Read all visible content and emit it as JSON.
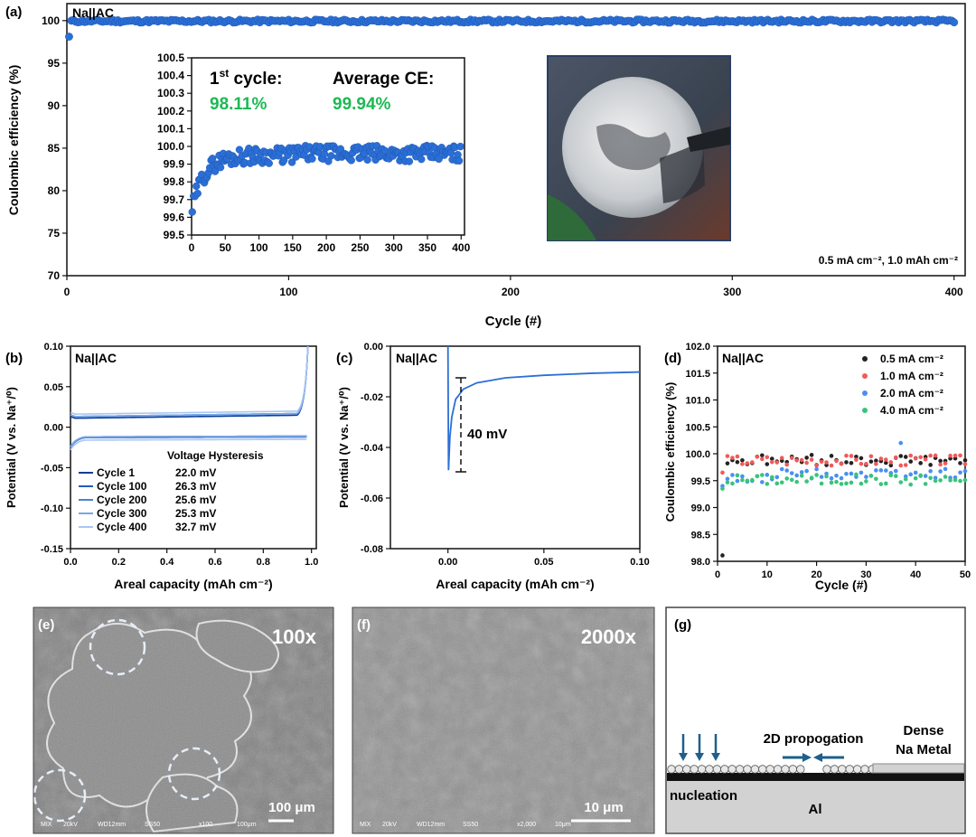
{
  "panel_a": {
    "label": "(a)",
    "tag": "Na||AC",
    "xlabel": "Cycle (#)",
    "ylabel": "Coulombic efficiency (%)",
    "conditions": "0.5 mA cm⁻², 1.0 mAh cm⁻²",
    "inset": {
      "first_cycle_label": "1st cycle:",
      "first_cycle_value": "98.11%",
      "avg_label": "Average CE:",
      "avg_value": "99.94%"
    }
  },
  "panel_b": {
    "label": "(b)",
    "tag": "Na||AC",
    "xlabel": "Areal capacity (mAh cm⁻²)",
    "ylabel": "Potential (V vs. Na⁺/⁰)",
    "legend_title": "Voltage Hysteresis",
    "legend": [
      {
        "name": "Cycle 1",
        "value": "22.0 mV"
      },
      {
        "name": "Cycle 100",
        "value": "26.3 mV"
      },
      {
        "name": "Cycle 200",
        "value": "25.6 mV"
      },
      {
        "name": "Cycle 300",
        "value": "25.3 mV"
      },
      {
        "name": "Cycle 400",
        "value": "32.7 mV"
      }
    ]
  },
  "panel_c": {
    "label": "(c)",
    "tag": "Na||AC",
    "xlabel": "Areal capacity (mAh cm⁻²)",
    "ylabel": "Potential (V vs. Na⁺/⁰)",
    "annotation": "40 mV"
  },
  "panel_d": {
    "label": "(d)",
    "tag": "Na||AC",
    "xlabel": "Cycle (#)",
    "ylabel": "Coulombic efficiency (%)",
    "legend": [
      "0.5 mA cm⁻²",
      "1.0 mA cm⁻²",
      "2.0 mA cm⁻²",
      "4.0 mA cm⁻²"
    ]
  },
  "panel_e": {
    "label": "(e)",
    "mag": "100x",
    "scale": "100 μm",
    "footer": [
      "MIX",
      "20kV",
      "WD12mm",
      "SS50",
      "x100",
      "100μm"
    ]
  },
  "panel_f": {
    "label": "(f)",
    "mag": "2000x",
    "scale": "10 μm",
    "footer": [
      "MIX",
      "20kV",
      "WD12mm",
      "SS50",
      "x2,000",
      "10μm"
    ]
  },
  "panel_g": {
    "label": "(g)",
    "propagation": "2D propogation",
    "dense_1": "Dense",
    "dense_2": "Na Metal",
    "nucleation": "nucleation",
    "substrate": "Al"
  },
  "colors": {
    "blue": "#2b6fd6",
    "black": "#222222",
    "red": "#f05a5a",
    "lightblue": "#4a8ff0",
    "green": "#39c47a"
  },
  "chart_data": [
    {
      "id": "a",
      "type": "scatter",
      "xlabel": "Cycle (#)",
      "ylabel": "Coulombic efficiency (%)",
      "xlim": [
        0,
        405
      ],
      "ylim": [
        70,
        102
      ],
      "xticks": [
        0,
        100,
        200,
        300,
        400
      ],
      "yticks": [
        70,
        75,
        80,
        85,
        90,
        95,
        100
      ],
      "series": [
        {
          "x_range": [
            1,
            400
          ],
          "first_value": 98.11,
          "steady_value": 99.94
        }
      ]
    },
    {
      "id": "a_inset",
      "type": "scatter",
      "xlim": [
        0,
        405
      ],
      "ylim": [
        99.5,
        100.5
      ],
      "xticks": [
        0,
        50,
        100,
        150,
        200,
        250,
        300,
        350,
        400
      ],
      "yticks": [
        99.5,
        99.6,
        99.7,
        99.8,
        99.9,
        100.0,
        100.1,
        100.2,
        100.3,
        100.4,
        100.5
      ],
      "series": [
        {
          "start": 99.63,
          "plateau": 99.95,
          "x_range": [
            1,
            400
          ]
        }
      ]
    },
    {
      "id": "b",
      "type": "line",
      "xlim": [
        0,
        1.02
      ],
      "ylim": [
        -0.15,
        0.1
      ],
      "xticks": [
        0.0,
        0.2,
        0.4,
        0.6,
        0.8,
        1.0
      ],
      "yticks": [
        -0.15,
        -0.1,
        -0.05,
        0.0,
        0.05,
        0.1
      ],
      "series": [
        {
          "name": "Cycle 1",
          "charge": 0.011,
          "discharge": -0.012
        },
        {
          "name": "Cycle 100",
          "charge": 0.013,
          "discharge": -0.013
        },
        {
          "name": "Cycle 200",
          "charge": 0.013,
          "discharge": -0.013
        },
        {
          "name": "Cycle 300",
          "charge": 0.013,
          "discharge": -0.012
        },
        {
          "name": "Cycle 400",
          "charge": 0.016,
          "discharge": -0.016
        }
      ]
    },
    {
      "id": "c",
      "type": "line",
      "xlim": [
        -0.03,
        0.1
      ],
      "ylim": [
        -0.08,
        0.0
      ],
      "xticks": [
        0.0,
        0.05,
        0.1
      ],
      "yticks": [
        -0.08,
        -0.06,
        -0.04,
        -0.02,
        0.0
      ],
      "series": [
        {
          "x": [
            0.0,
            0.0003,
            0.001,
            0.002,
            0.004,
            0.008,
            0.015,
            0.03,
            0.05,
            0.075,
            0.1
          ],
          "y": [
            0.0,
            -0.049,
            -0.036,
            -0.028,
            -0.021,
            -0.017,
            -0.0145,
            -0.0125,
            -0.0115,
            -0.0107,
            -0.0102
          ]
        }
      ]
    },
    {
      "id": "d",
      "type": "scatter",
      "xlim": [
        0,
        50
      ],
      "ylim": [
        98.0,
        102.0
      ],
      "xticks": [
        0,
        10,
        20,
        30,
        40,
        50
      ],
      "yticks": [
        98.0,
        98.5,
        99.0,
        99.5,
        100.0,
        100.5,
        101.0,
        101.5,
        102.0
      ],
      "series": [
        {
          "name": "0.5 mA cm⁻²",
          "first": 98.11,
          "mean": 99.88
        },
        {
          "name": "1.0 mA cm⁻²",
          "first": 99.65,
          "mean": 99.88
        },
        {
          "name": "2.0 mA cm⁻²",
          "first": 99.4,
          "mean": 99.62
        },
        {
          "name": "4.0 mA cm⁻²",
          "first": 99.35,
          "mean": 99.52
        }
      ]
    }
  ]
}
